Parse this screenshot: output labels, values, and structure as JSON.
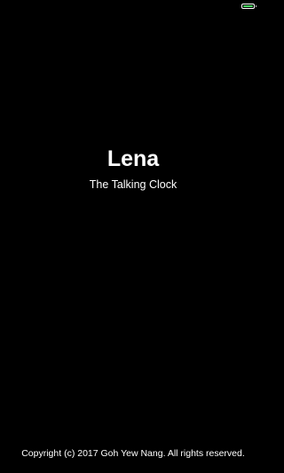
{
  "status_bar": {
    "battery_icon": "battery-icon",
    "battery_level": 1.0,
    "battery_color": "#4cd964"
  },
  "app": {
    "title": "Lena",
    "subtitle": "The Talking Clock"
  },
  "footer": {
    "copyright": "Copyright (c) 2017 Goh Yew Nang. All rights reserved."
  },
  "colors": {
    "background": "#000000",
    "text": "#ffffff"
  }
}
